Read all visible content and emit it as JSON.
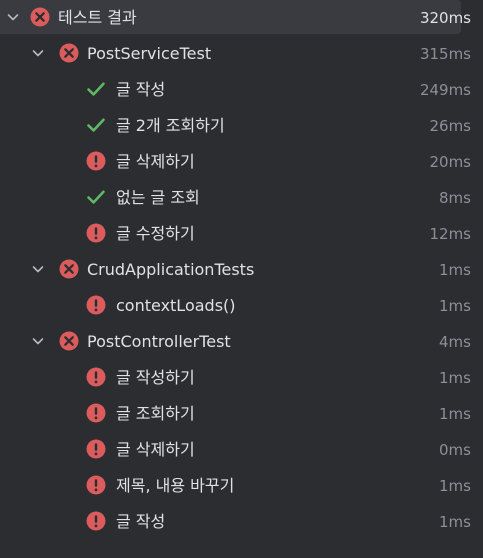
{
  "colors": {
    "background": "#2b2d30",
    "selection": "#393b40",
    "failed": "#db5c5c",
    "passed": "#5fb865",
    "text": "#dfe1e5",
    "duration": "#8c8f94"
  },
  "rows": [
    {
      "level": 0,
      "label": "테스트 결과",
      "duration": "320ms",
      "status": "failed",
      "icon": "failed-circle-x-icon",
      "expandable": true,
      "selected": true
    },
    {
      "level": 1,
      "label": "PostServiceTest",
      "duration": "315ms",
      "status": "failed",
      "icon": "failed-circle-x-icon",
      "expandable": true,
      "selected": false
    },
    {
      "level": 2,
      "label": "글 작성",
      "duration": "249ms",
      "status": "passed",
      "icon": "checkmark-icon",
      "expandable": false,
      "selected": false
    },
    {
      "level": 2,
      "label": "글 2개 조회하기",
      "duration": "26ms",
      "status": "passed",
      "icon": "checkmark-icon",
      "expandable": false,
      "selected": false
    },
    {
      "level": 2,
      "label": "글 삭제하기",
      "duration": "20ms",
      "status": "failed",
      "icon": "error-exclamation-icon",
      "expandable": false,
      "selected": false
    },
    {
      "level": 2,
      "label": "없는 글 조회",
      "duration": "8ms",
      "status": "passed",
      "icon": "checkmark-icon",
      "expandable": false,
      "selected": false
    },
    {
      "level": 2,
      "label": "글 수정하기",
      "duration": "12ms",
      "status": "failed",
      "icon": "error-exclamation-icon",
      "expandable": false,
      "selected": false
    },
    {
      "level": 1,
      "label": "CrudApplicationTests",
      "duration": "1ms",
      "status": "failed",
      "icon": "failed-circle-x-icon",
      "expandable": true,
      "selected": false
    },
    {
      "level": 2,
      "label": "contextLoads()",
      "duration": "1ms",
      "status": "failed",
      "icon": "error-exclamation-icon",
      "expandable": false,
      "selected": false
    },
    {
      "level": 1,
      "label": "PostControllerTest",
      "duration": "4ms",
      "status": "failed",
      "icon": "failed-circle-x-icon",
      "expandable": true,
      "selected": false
    },
    {
      "level": 2,
      "label": "글 작성하기",
      "duration": "1ms",
      "status": "failed",
      "icon": "error-exclamation-icon",
      "expandable": false,
      "selected": false
    },
    {
      "level": 2,
      "label": "글 조회하기",
      "duration": "1ms",
      "status": "failed",
      "icon": "error-exclamation-icon",
      "expandable": false,
      "selected": false
    },
    {
      "level": 2,
      "label": "글 삭제하기",
      "duration": "0ms",
      "status": "failed",
      "icon": "error-exclamation-icon",
      "expandable": false,
      "selected": false
    },
    {
      "level": 2,
      "label": "제목, 내용 바꾸기",
      "duration": "1ms",
      "status": "failed",
      "icon": "error-exclamation-icon",
      "expandable": false,
      "selected": false
    },
    {
      "level": 2,
      "label": "글 작성",
      "duration": "1ms",
      "status": "failed",
      "icon": "error-exclamation-icon",
      "expandable": false,
      "selected": false
    }
  ]
}
